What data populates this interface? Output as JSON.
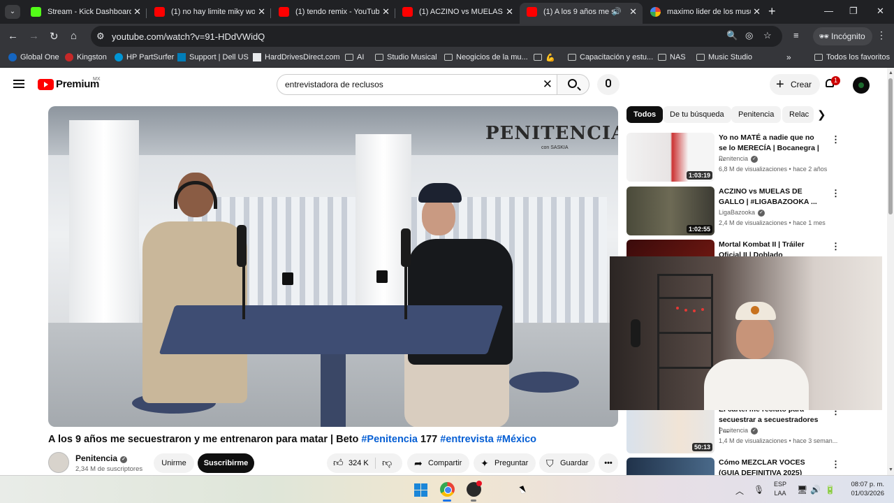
{
  "browser": {
    "tabs": [
      {
        "title": "Stream - Kick Dashboard",
        "favicon": "kick-icon"
      },
      {
        "title": "(1) no hay limite miky woo",
        "favicon": "youtube-icon"
      },
      {
        "title": "(1) tendo remix - YouTube",
        "favicon": "youtube-icon"
      },
      {
        "title": "(1) ACZINO vs MUELAS DE",
        "favicon": "youtube-icon"
      },
      {
        "title": "(1) A los 9 años me sec",
        "favicon": "youtube-icon",
        "active": true
      },
      {
        "title": "maximo lider de los musul",
        "favicon": "google-icon"
      }
    ],
    "url": "youtube.com/watch?v=91-HDdVWidQ",
    "incognito_label": "Incógnito",
    "bookmarks": [
      "Global One",
      "Kingston",
      "HP PartSurfer",
      "Support | Dell US",
      "HardDrivesDirect.com",
      "AI",
      "Studio Musical",
      "Neogicios de la mu...",
      "💪",
      "Capacitación y estu...",
      "NAS",
      "Music Studio"
    ],
    "all_bookmarks_label": "Todos los favoritos"
  },
  "youtube": {
    "logo_text": "Premium",
    "logo_region": "MX",
    "search_query": "entrevistadora de reclusos",
    "create_label": "Crear",
    "notification_count": "1",
    "colors": {
      "brand_red": "#ff0000",
      "link_blue": "#065fd4",
      "text": "#0f0f0f",
      "secondary": "#606060"
    }
  },
  "video": {
    "title_main": "A los 9 años me secuestraron y me entrenaron para matar | Beto ",
    "tag1": "#Penitencia",
    "title_num": " 177 ",
    "tag2": "#entrevista",
    "tag3": "#México",
    "watermark": "PENITENCIA",
    "watermark_sub": "con SASKIA",
    "channel": "Penitencia",
    "subscribers": "2,34 M de suscriptores",
    "join_label": "Unirme",
    "subscribe_label": "Suscribirme",
    "likes": "324 K",
    "share_label": "Compartir",
    "ask_label": "Preguntar",
    "save_label": "Guardar"
  },
  "chips": [
    "Todos",
    "De tu búsqueda",
    "Penitencia",
    "Relac"
  ],
  "recommendations": [
    {
      "title": "Yo no MATÉ a nadie que no se lo MERECÍA | Bocanegra | ...",
      "channel": "Penitencia",
      "meta": "6,8 M de visualizaciones • hace 2 años",
      "duration": "1:03:19"
    },
    {
      "title": "ACZINO vs MUELAS DE GALLO | #LIGABAZOOKA ...",
      "channel": "LigaBazooka",
      "meta": "2,4 M de visualizaciones • hace 1 mes",
      "duration": "1:02:55"
    },
    {
      "title": "Mortal Kombat II | Tráiler Oficial II | Doblado",
      "channel": "",
      "meta": "",
      "duration": ""
    },
    {
      "title": "El cártel me reclutó para secuestrar a secuestradores | ...",
      "channel": "Penitencia",
      "meta": "1,4 M de visualizaciones • hace 3 seman...",
      "duration": "50:13"
    },
    {
      "title": "Cómo MEZCLAR VOCES (GUIA DEFINITIVA 2025)",
      "channel": "",
      "meta": "",
      "duration": ""
    }
  ],
  "taskbar": {
    "lang_top": "ESP",
    "lang_bottom": "LAA",
    "time": "08:07 p. m.",
    "date": "01/03/2026"
  }
}
